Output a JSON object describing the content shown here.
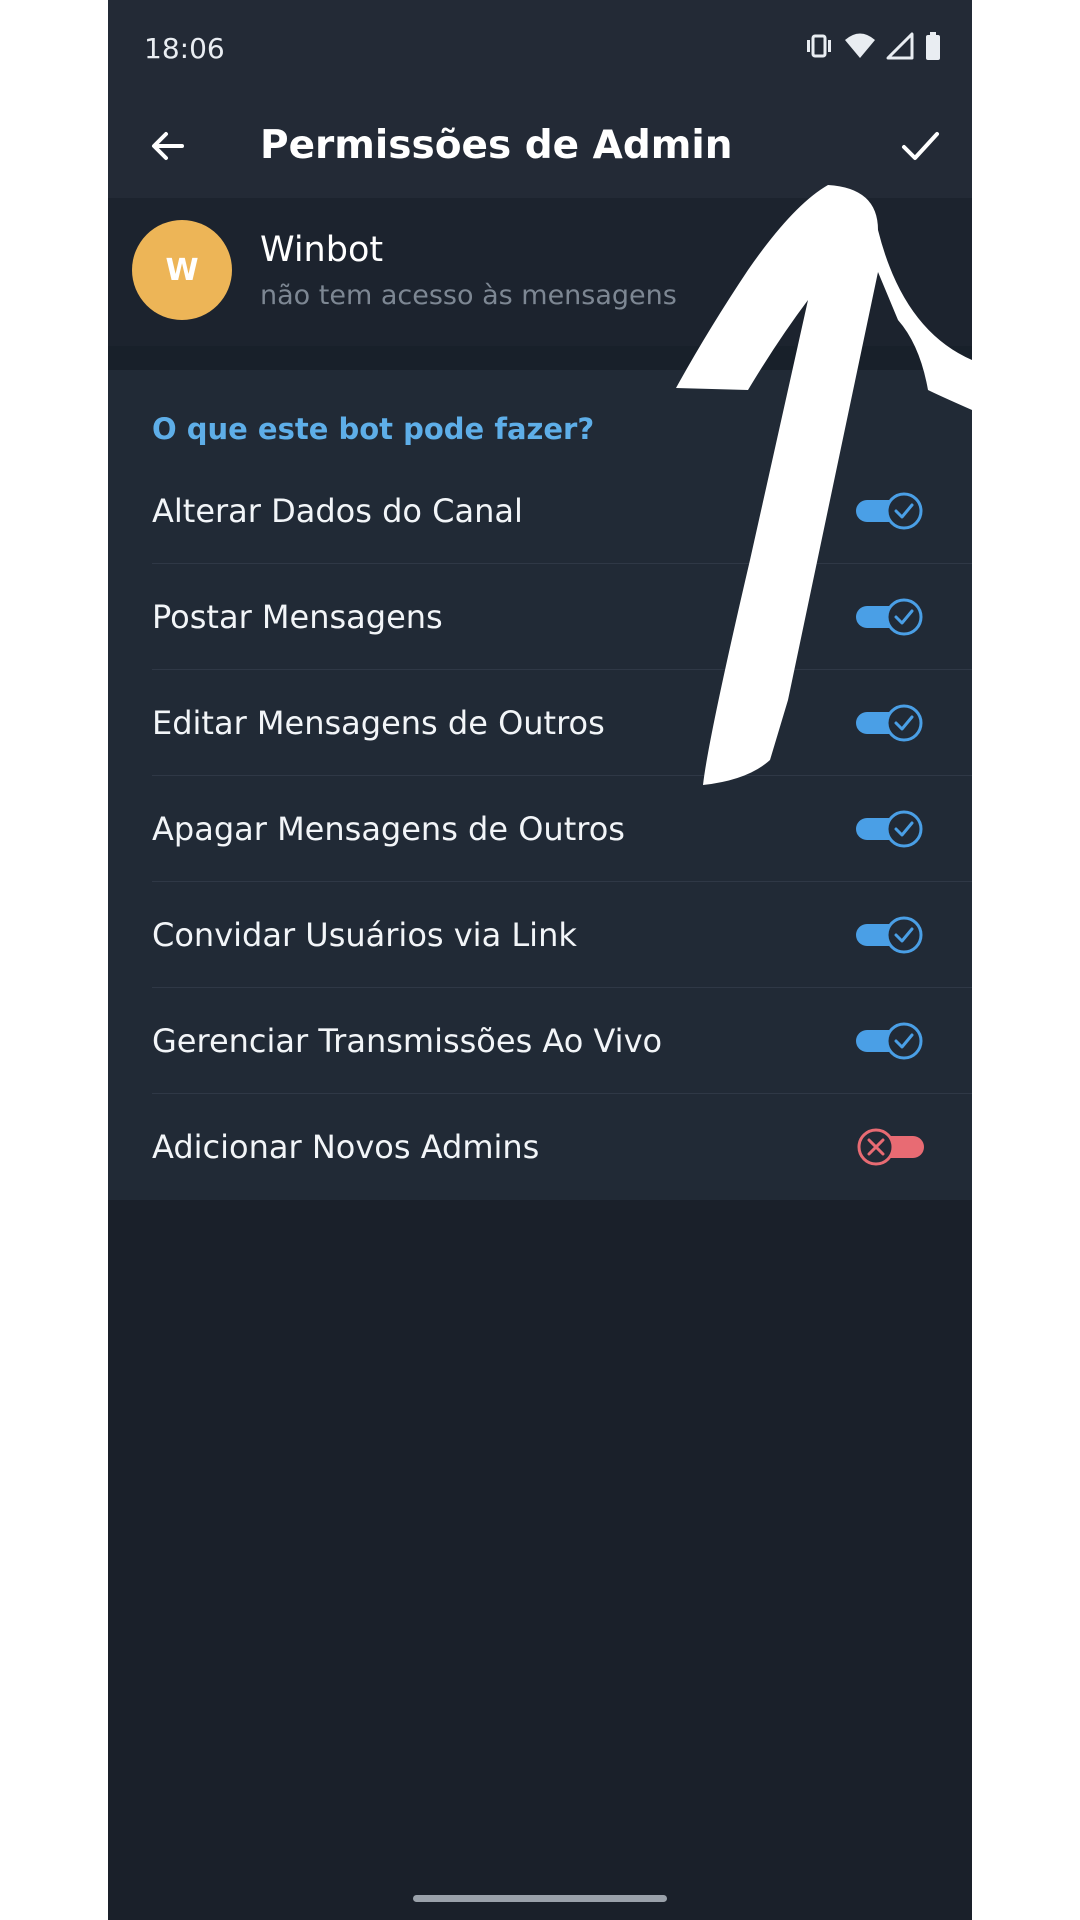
{
  "status_bar": {
    "time": "18:06",
    "icons": [
      "vibrate-icon",
      "wifi-icon",
      "signal-icon",
      "battery-icon"
    ]
  },
  "app_bar": {
    "title": "Permissões de Admin",
    "back_icon": "arrow-left-icon",
    "save_icon": "check-icon"
  },
  "bot": {
    "avatar_letter": "W",
    "name": "Winbot",
    "subtitle": "não tem acesso às mensagens",
    "avatar_color": "#edb557"
  },
  "permissions": {
    "header": "O que este bot pode fazer?",
    "items": [
      {
        "label": "Alterar Dados do Canal",
        "enabled": true
      },
      {
        "label": "Postar Mensagens",
        "enabled": true
      },
      {
        "label": "Editar Mensagens de Outros",
        "enabled": true
      },
      {
        "label": "Apagar Mensagens de Outros",
        "enabled": true
      },
      {
        "label": "Convidar Usuários via Link",
        "enabled": true
      },
      {
        "label": "Gerenciar Transmissões Ao Vivo",
        "enabled": true
      },
      {
        "label": "Adicionar Novos Admins",
        "enabled": false
      }
    ]
  },
  "colors": {
    "accent": "#5eaee8",
    "toggle_on": "#4a9fe6",
    "toggle_off": "#e86b73",
    "background": "#1a202a",
    "surface": "#212a36"
  }
}
